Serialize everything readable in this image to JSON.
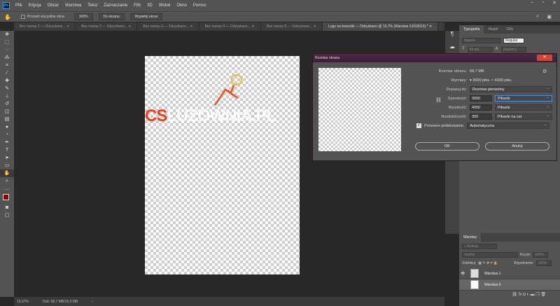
{
  "app": {
    "logo": "Ps",
    "menu": [
      "Plik",
      "Edycja",
      "Obraz",
      "Warstwa",
      "Tekst",
      "Zaznaczanie",
      "Filtr",
      "3D",
      "Widok",
      "Okno",
      "Pomoc"
    ]
  },
  "options": {
    "scroll_all": "Przewiń wszystkie okna",
    "zoom100": "100%",
    "fit_screen": "Do ekranu",
    "fill_screen": "Wypełnij ekran"
  },
  "tabs": [
    "Bez nazwy-1 — Odzyskano...",
    "Bez nazwy-2 — Odzyskano...",
    "Bez nazwy-3 — Odzyskano...",
    "Bez nazwy-4 — Odzyskano...",
    "Bez nazwy-5 — Odzyskano...",
    "Logo na koszulki — Odzyskano @ 16,7% (Warstwa 0,RGB/16) *"
  ],
  "canvas": {
    "logo_red": "CS",
    "logo_white": "LUZOWNIA.PL"
  },
  "status": {
    "zoom": "16,67%",
    "doc": "Dok: 68,7 MB/16,0 MB"
  },
  "typography": {
    "tabs": [
      "Typografia",
      "Akapit",
      "Glify"
    ],
    "font": "Agaela",
    "style": "Regular",
    "size": "60 pkt",
    "leading": "(Autom.)"
  },
  "layers": {
    "title": "Warstwy",
    "filter": "Rodzaj",
    "blend": "Zwykły",
    "opacity_label": "Krycie:",
    "opacity": "100%",
    "lock_label": "Zablokuj:",
    "fill_label": "Wypełnienie:",
    "fill": "100%",
    "items": [
      {
        "name": "Warstwa 1",
        "visible": true
      },
      {
        "name": "Warstwa 0",
        "visible": false
      }
    ]
  },
  "dialog": {
    "title": "Rozmiar obrazu",
    "size_label": "Rozmiar obrazu:",
    "size": "68,7 MB",
    "dims_label": "Wymiary:",
    "dims": "3000 piks. × 4000 piks.",
    "fit_label": "Dopasuj do:",
    "fit": "Rozmiar pierwotny",
    "width_label": "Szerokość:",
    "width": "3000",
    "width_unit": "Piksele",
    "height_label": "Wysokość:",
    "height": "4000",
    "height_unit": "Piksele",
    "res_label": "Rozdzielczość:",
    "res": "300",
    "res_unit": "Piksele na cal",
    "resample_label": "Ponowne próbkowanie:",
    "resample": "Automatyczna",
    "ok": "OK",
    "cancel": "Anuluj"
  }
}
